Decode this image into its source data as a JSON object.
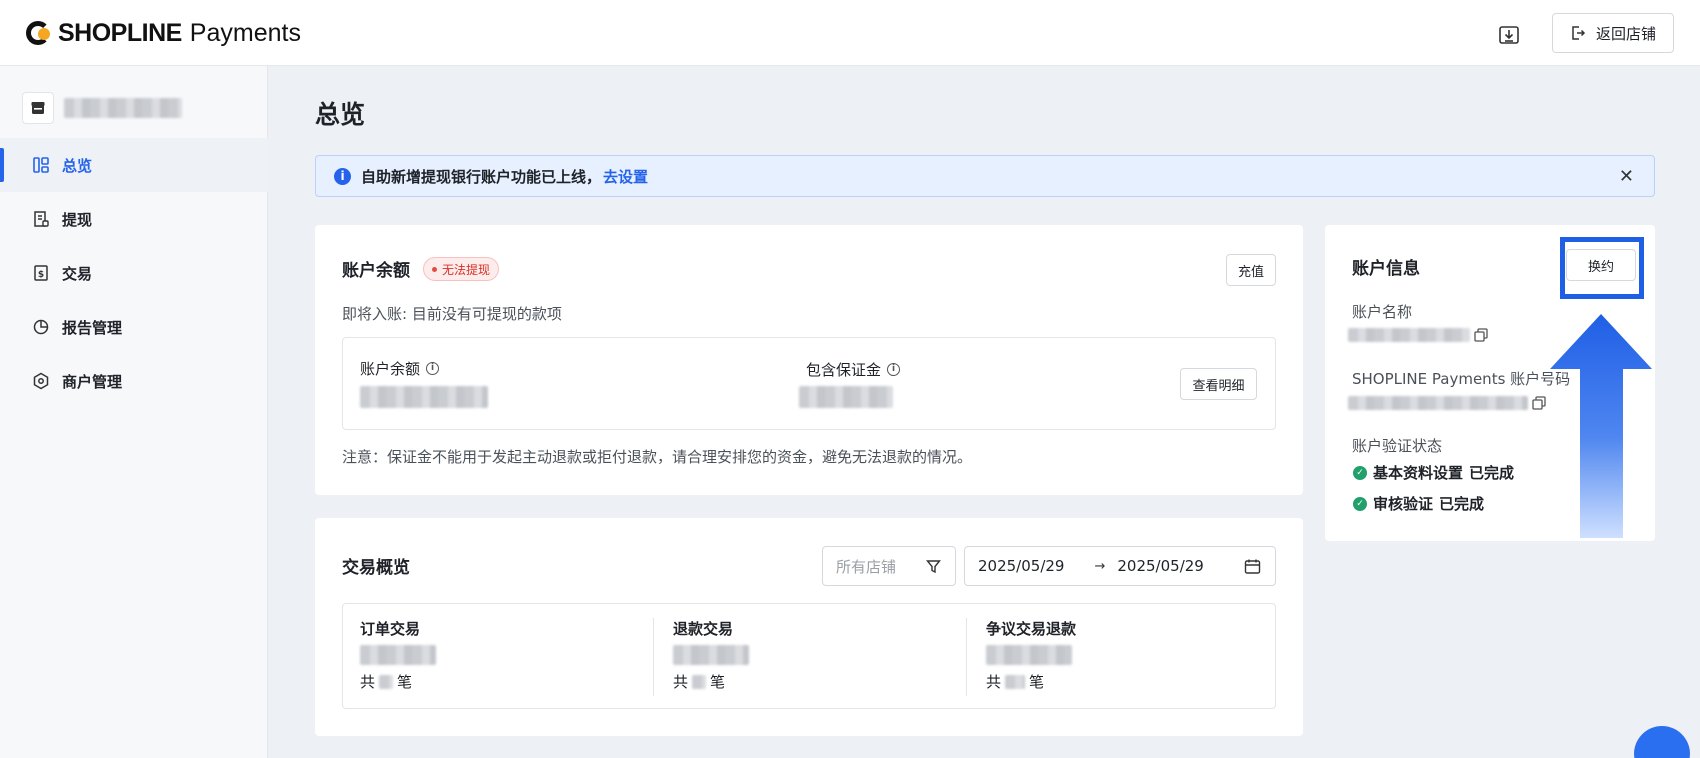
{
  "header": {
    "brand": "SHOPLINE",
    "product": "Payments",
    "back_label": "返回店铺"
  },
  "sidebar": {
    "items": [
      {
        "label": "总览"
      },
      {
        "label": "提现"
      },
      {
        "label": "交易"
      },
      {
        "label": "报告管理"
      },
      {
        "label": "商户管理"
      }
    ]
  },
  "page": {
    "title": "总览",
    "notice_text": "自助新增提现银行账户功能已上线，",
    "notice_link": "去设置"
  },
  "balance_card": {
    "title": "账户余额",
    "status_badge": "无法提现",
    "recharge_label": "充值",
    "pending_text": "即将入账: 目前没有可提现的款项",
    "balance_label": "账户余额",
    "deposit_label": "包含保证金",
    "details_label": "查看明细",
    "note": "注意：保证金不能用于发起主动退款或拒付退款，请合理安排您的资金，避免无法退款的情况。"
  },
  "trade_card": {
    "title": "交易概览",
    "store_placeholder": "所有店铺",
    "date_from": "2025/05/29",
    "date_sep": "→",
    "date_to": "2025/05/29",
    "columns": [
      {
        "label": "订单交易",
        "count_prefix": "共",
        "count_suffix": "笔"
      },
      {
        "label": "退款交易",
        "count_prefix": "共",
        "count_suffix": "笔"
      },
      {
        "label": "争议交易退款",
        "count_prefix": "共",
        "count_suffix": "笔"
      }
    ]
  },
  "account_card": {
    "title": "账户信息",
    "change_label": "换约",
    "name_label": "账户名称",
    "number_label": "SHOPLINE Payments 账户号码",
    "verify_label": "账户验证状态",
    "verify_items": [
      {
        "label": "基本资料设置",
        "status": "已完成"
      },
      {
        "label": "审核验证",
        "status": "已完成"
      }
    ]
  },
  "colors": {
    "accent": "#2563eb",
    "highlight": "#1f5fe6",
    "success": "#22a06b",
    "danger": "#d93026"
  }
}
